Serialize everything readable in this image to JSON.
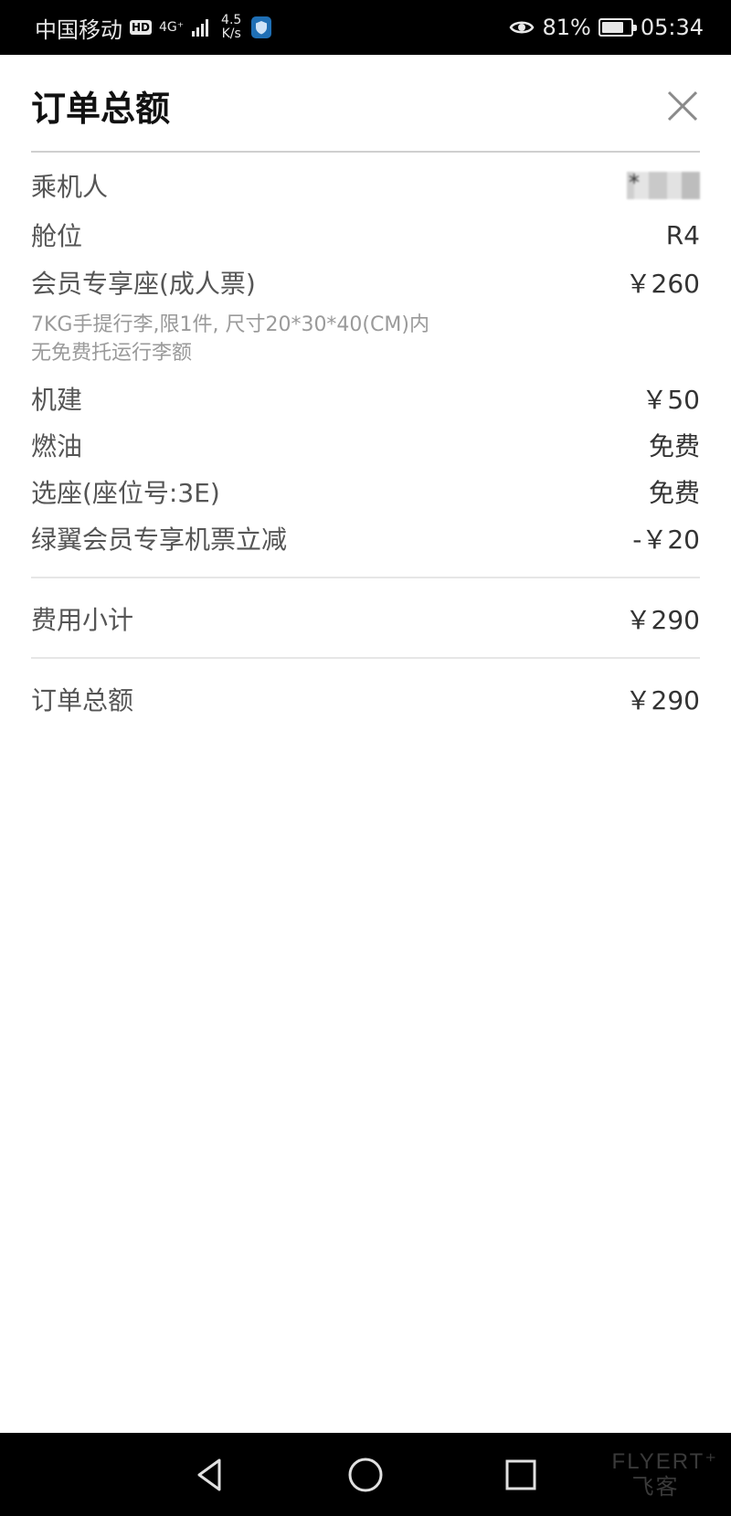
{
  "status_bar": {
    "carrier": "中国移动",
    "hd": "HD",
    "network": "4G⁺",
    "speed_top": "4.5",
    "speed_bottom": "K/s",
    "battery": "81%",
    "battery_level": 0.81,
    "time": "05:34"
  },
  "sheet": {
    "title": "订单总额"
  },
  "rows": {
    "passenger": {
      "label": "乘机人",
      "value": "*"
    },
    "cabin": {
      "label": "舱位",
      "value": "R4"
    },
    "seat_fare": {
      "label": "会员专享座(成人票)",
      "value": "￥260"
    },
    "note_line1": "7KG手提行李,限1件, 尺寸20*30*40(CM)内",
    "note_line2": "无免费托运行李额",
    "airport_fee": {
      "label": "机建",
      "value": "￥50"
    },
    "fuel": {
      "label": "燃油",
      "value": "免费"
    },
    "seat_select": {
      "label": "选座(座位号:3E)",
      "value": "免费"
    },
    "discount": {
      "label": "绿翼会员专享机票立减",
      "value": "-￥20"
    },
    "subtotal": {
      "label": "费用小计",
      "value": "￥290"
    },
    "total": {
      "label": "订单总额",
      "value": "￥290"
    }
  },
  "watermark": {
    "line1": "FLYERT⁺",
    "line2": "飞客"
  }
}
